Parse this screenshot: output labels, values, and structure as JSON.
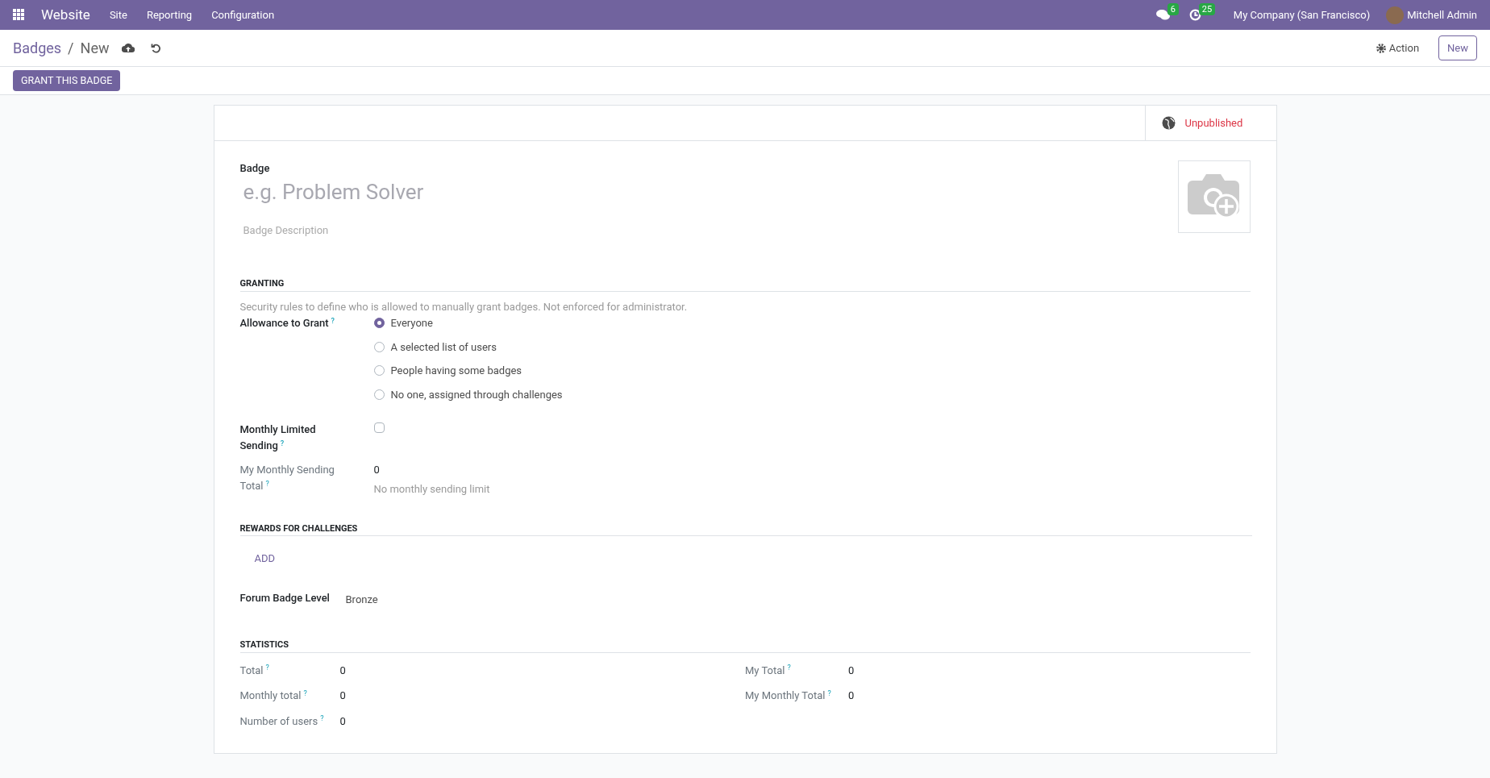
{
  "navbar": {
    "app": "Website",
    "menus": [
      "Site",
      "Reporting",
      "Configuration"
    ],
    "messages_count": "6",
    "activities_count": "25",
    "company": "My Company (San Francisco)",
    "user": "Mitchell Admin"
  },
  "breadcrumb": {
    "parent": "Badges",
    "separator": "/",
    "current": "New"
  },
  "control_panel": {
    "action": "Action",
    "new_button": "New"
  },
  "status_buttons": [
    "GRANT THIS BADGE"
  ],
  "sheet": {
    "publish_state": {
      "label": "Unpublished",
      "published": false
    },
    "name_label": "Badge",
    "name_placeholder": "e.g. Problem Solver",
    "description_placeholder": "Badge Description",
    "granting": {
      "title": "GRANTING",
      "help_text": "Security rules to define who is allowed to manually grant badges. Not enforced for administrator.",
      "allowance": {
        "label": "Allowance to Grant",
        "help": "?",
        "options": [
          {
            "label": "Everyone",
            "selected": true
          },
          {
            "label": "A selected list of users",
            "selected": false
          },
          {
            "label": "People having some badges",
            "selected": false
          },
          {
            "label": "No one, assigned through challenges",
            "selected": false
          }
        ]
      },
      "monthly_limited": {
        "label": "Monthly Limited Sending",
        "help": "?",
        "checked": false
      },
      "sending_total": {
        "label": "My Monthly Sending Total",
        "help": "?",
        "value": "0",
        "note": "No monthly sending limit"
      }
    },
    "rewards": {
      "title": "REWARDS FOR CHALLENGES",
      "add": "ADD",
      "level_label": "Forum Badge Level",
      "level_value": "Bronze"
    },
    "statistics": {
      "title": "STATISTICS",
      "left": [
        {
          "label": "Total",
          "help": "?",
          "value": "0"
        },
        {
          "label": "Monthly total",
          "help": "?",
          "value": "0"
        },
        {
          "label": "Number of users",
          "help": "?",
          "value": "0"
        }
      ],
      "right": [
        {
          "label": "My Total",
          "help": "?",
          "value": "0"
        },
        {
          "label": "My Monthly Total",
          "help": "?",
          "value": "0"
        }
      ]
    }
  }
}
